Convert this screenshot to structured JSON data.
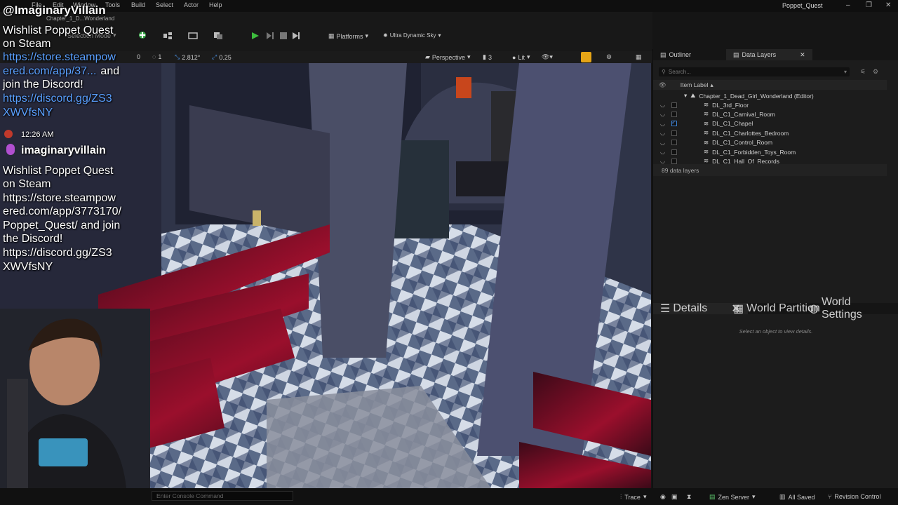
{
  "titlebar": {
    "menus": [
      "File",
      "Edit",
      "Window",
      "Tools",
      "Build",
      "Select",
      "Actor",
      "Help"
    ],
    "project_tab": "Chapter_1_D...Wonderland",
    "app_title": "Poppet_Quest",
    "minimize_glyph": "–",
    "maximize_glyph": "❐",
    "close_glyph": "✕"
  },
  "toolbar": {
    "mode_label": "Selection Mode",
    "platforms_label": "Platforms",
    "sky_label": "Ultra Dynamic Sky"
  },
  "viewport_bar": {
    "grid_snap": "0",
    "rotation_snap": "1",
    "scale_snap": "2.812°",
    "camera_speed": "0.25",
    "perspective_label": "Perspective",
    "camera_count": "3",
    "lit_label": "Lit"
  },
  "overlay": {
    "handle": "@ImaginaryVillain",
    "promo_line1": "Wishlist Poppet Quest",
    "promo_line2": "on Steam",
    "promo_link_a": "https://store.steampow",
    "promo_link_b": "ered.com/app/37...",
    "promo_after_link": "and",
    "promo_join": "join the Discord!",
    "discord_a": "https://discord.gg/ZS3",
    "discord_b": "XWVfsNY",
    "time": "12:26 AM",
    "chat_user": "imaginaryvillain",
    "chat_lines": [
      "Wishlist Poppet Quest",
      "on Steam",
      "https://store.steampow",
      "ered.com/app/3773170/",
      "Poppet_Quest/ and join",
      "the Discord!",
      "https://discord.gg/ZS3",
      "XWVfsNY"
    ]
  },
  "outliner": {
    "tab_outliner": "Outliner",
    "tab_data_layers": "Data Layers",
    "search_placeholder": "Search...",
    "column_header": "Item Label",
    "root": "Chapter_1_Dead_Girl_Wonderland (Editor)",
    "layers": [
      {
        "label": "DL_3rd_Floor",
        "checked": false
      },
      {
        "label": "DL_C1_Carnival_Room",
        "checked": false
      },
      {
        "label": "DL_C1_Chapel",
        "checked": true
      },
      {
        "label": "DL_C1_Charlottes_Bedroom",
        "checked": false
      },
      {
        "label": "DL_C1_Control_Room",
        "checked": false
      },
      {
        "label": "DL_C1_Forbidden_Toys_Room",
        "checked": false
      },
      {
        "label": "DL_C1_Hall_Of_Records",
        "checked": false
      }
    ],
    "count_text": "89 data layers"
  },
  "details": {
    "tab_details": "Details",
    "tab_world_partition": "World Partition",
    "tab_world_settings": "World Settings",
    "empty_text": "Select an object to view details."
  },
  "statusbar": {
    "console_placeholder": "Enter Console Command",
    "trace_label": "Trace",
    "zen_label": "Zen Server",
    "saved_label": "All Saved",
    "revision_label": "Revision Control"
  }
}
